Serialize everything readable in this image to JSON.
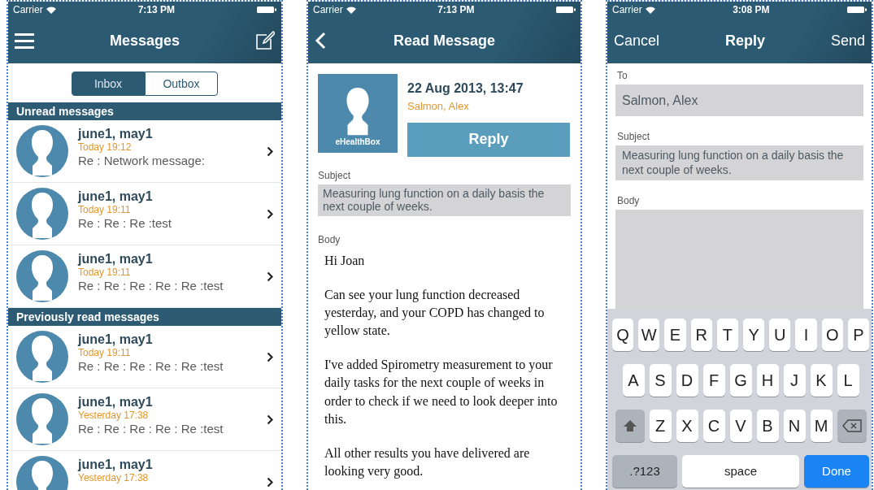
{
  "screens": [
    {
      "kind": "inbox",
      "status_bar": {
        "carrier": "Carrier",
        "time": "7:13 PM"
      },
      "nav": {
        "title": "Messages"
      },
      "segments": [
        {
          "label": "Inbox",
          "selected": true
        },
        {
          "label": "Outbox",
          "selected": false
        }
      ],
      "sections": [
        {
          "title": "Unread messages",
          "messages": [
            {
              "sender": "june1, may1",
              "time": "Today 19:12",
              "preview": "Re : Network message:"
            },
            {
              "sender": "june1, may1",
              "time": "Today 19:11",
              "preview": "Re : Re : Re :test"
            },
            {
              "sender": "june1, may1",
              "time": "Today 19:11",
              "preview": "Re : Re : Re : Re : Re :test"
            }
          ]
        },
        {
          "title": "Previously read messages",
          "messages": [
            {
              "sender": "june1, may1",
              "time": "Today 19:11",
              "preview": "Re : Re : Re : Re : Re :test"
            },
            {
              "sender": "june1, may1",
              "time": "Yesterday 17:38",
              "preview": "Re : Re : Re : Re : Re :test"
            },
            {
              "sender": "june1, may1",
              "time": "Yesterday 17:38"
            }
          ]
        }
      ]
    },
    {
      "kind": "read",
      "status_bar": {
        "carrier": "Carrier",
        "time": "7:13 PM"
      },
      "nav": {
        "title": "Read Message"
      },
      "avatar_label": "eHealthBox",
      "date": "22 Aug 2013, 13:47",
      "sender": "Salmon, Alex",
      "reply_button": "Reply",
      "subject_label": "Subject",
      "subject": "Measuring lung function on a daily basis the next couple of weeks.",
      "body_label": "Body",
      "body": [
        "Hi Joan",
        "Can see your lung function decreased yesterday, and your COPD has changed to yellow state.",
        "I've added Spirometry measurement to your daily tasks for the next couple of weeks in order to check if we need to look deeper into this.",
        "All other results you have delivered are looking very good."
      ]
    },
    {
      "kind": "compose",
      "status_bar": {
        "carrier": "Carrier",
        "time": "3:08 PM"
      },
      "nav": {
        "left": "Cancel",
        "title": "Reply",
        "right": "Send"
      },
      "fields": [
        {
          "kind": "line",
          "label": "To",
          "value": "Salmon, Alex"
        },
        {
          "kind": "line",
          "label": "Subject",
          "value": "Measuring lung function on a daily basis the next couple of weeks."
        },
        {
          "kind": "area",
          "label": "Body"
        }
      ],
      "keyboard": [
        [
          {
            "kind": "letter",
            "label": "Q"
          },
          {
            "kind": "letter",
            "label": "W"
          },
          {
            "kind": "letter",
            "label": "E"
          },
          {
            "kind": "letter",
            "label": "R"
          },
          {
            "kind": "letter",
            "label": "T"
          },
          {
            "kind": "letter",
            "label": "Y"
          },
          {
            "kind": "letter",
            "label": "U"
          },
          {
            "kind": "letter",
            "label": "I"
          },
          {
            "kind": "letter",
            "label": "O"
          },
          {
            "kind": "letter",
            "label": "P"
          }
        ],
        [
          {
            "kind": "letter",
            "label": "A"
          },
          {
            "kind": "letter",
            "label": "S"
          },
          {
            "kind": "letter",
            "label": "D"
          },
          {
            "kind": "letter",
            "label": "F"
          },
          {
            "kind": "letter",
            "label": "G"
          },
          {
            "kind": "letter",
            "label": "H"
          },
          {
            "kind": "letter",
            "label": "J"
          },
          {
            "kind": "letter",
            "label": "K"
          },
          {
            "kind": "letter",
            "label": "L"
          }
        ],
        [
          {
            "kind": "shift"
          },
          {
            "kind": "letter",
            "label": "Z"
          },
          {
            "kind": "letter",
            "label": "X"
          },
          {
            "kind": "letter",
            "label": "C"
          },
          {
            "kind": "letter",
            "label": "V"
          },
          {
            "kind": "letter",
            "label": "B"
          },
          {
            "kind": "letter",
            "label": "N"
          },
          {
            "kind": "letter",
            "label": "M"
          },
          {
            "kind": "backspace"
          }
        ],
        [
          {
            "kind": "mode",
            "label": ".?123"
          },
          {
            "kind": "space",
            "label": "space"
          },
          {
            "kind": "done",
            "label": "Done"
          }
        ]
      ]
    }
  ]
}
